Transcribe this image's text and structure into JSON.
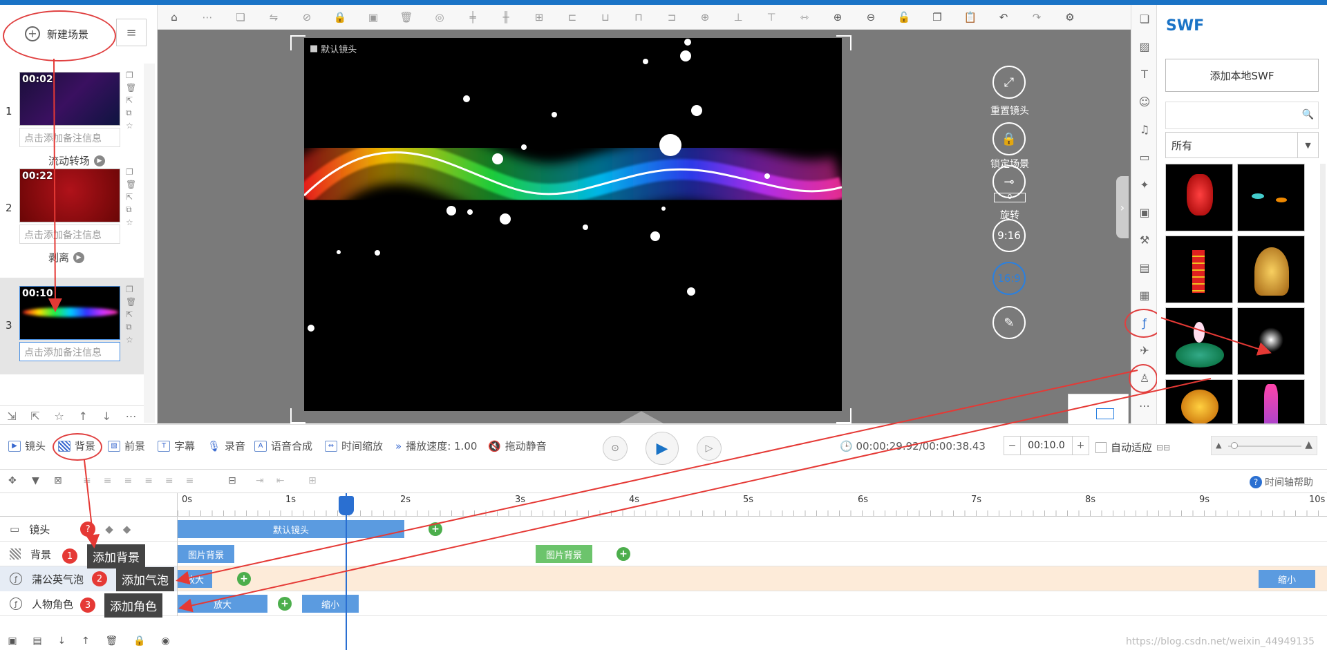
{
  "scene_panel": {
    "new_scene_label": "新建场景",
    "scenes": [
      {
        "number": "1",
        "time": "00:02",
        "note": "点击添加备注信息",
        "transition": "流动转场",
        "thumb_color": "#1a1040"
      },
      {
        "number": "2",
        "time": "00:22",
        "note": "点击添加备注信息",
        "transition": "剥离",
        "thumb_color": "#8a0b0b"
      },
      {
        "number": "3",
        "time": "00:10",
        "note": "点击添加备注信息",
        "transition": "",
        "thumb_color": "#000000"
      }
    ]
  },
  "canvas": {
    "camera_label": "默认镜头",
    "controls": {
      "reset_camera": "重置镜头",
      "lock_scene": "锁定场景",
      "rotate": "旋转",
      "rotate_value": "0",
      "ratio_portrait": "9:16",
      "ratio_landscape": "16:9"
    }
  },
  "swf_panel": {
    "title": "SWF",
    "add_local_label": "添加本地SWF",
    "search_placeholder": "",
    "filter_value": "所有"
  },
  "timeline": {
    "tools": {
      "camera": "镜头",
      "background": "背景",
      "foreground": "前景",
      "subtitle": "字幕",
      "record": "录音",
      "tts": "语音合成",
      "time_scale": "时间缩放",
      "speed": "播放速度: 1.00",
      "mute": "拖动静音"
    },
    "timecode": "00:00:29.92/00:00:38.43",
    "step_value": "00:10.0",
    "auto_fit": "自动适应",
    "help": "时间轴帮助",
    "ruler": [
      "0s",
      "1s",
      "2s",
      "3s",
      "4s",
      "5s",
      "6s",
      "7s",
      "8s",
      "9s",
      "10s"
    ],
    "tracks": [
      {
        "name": "镜头",
        "clips": [
          "默认镜头"
        ]
      },
      {
        "name": "背景",
        "clips": [
          "图片背景",
          "图片背景"
        ]
      },
      {
        "name": "蒲公英气泡",
        "clips": [
          "放大",
          "缩小"
        ]
      },
      {
        "name": "人物角色",
        "clips": [
          "放大",
          "缩小"
        ]
      }
    ],
    "callouts": [
      {
        "num": "1",
        "text": "添加背景"
      },
      {
        "num": "2",
        "text": "添加气泡"
      },
      {
        "num": "3",
        "text": "添加角色"
      }
    ]
  },
  "watermark": "https://blog.csdn.net/weixin_44949135",
  "colors": {
    "accent": "#1a73c6",
    "annotation_red": "#e53935",
    "clip_blue": "#5b9be0",
    "clip_green": "#6cc46c",
    "bubble_track_bg": "#fdebd9"
  }
}
